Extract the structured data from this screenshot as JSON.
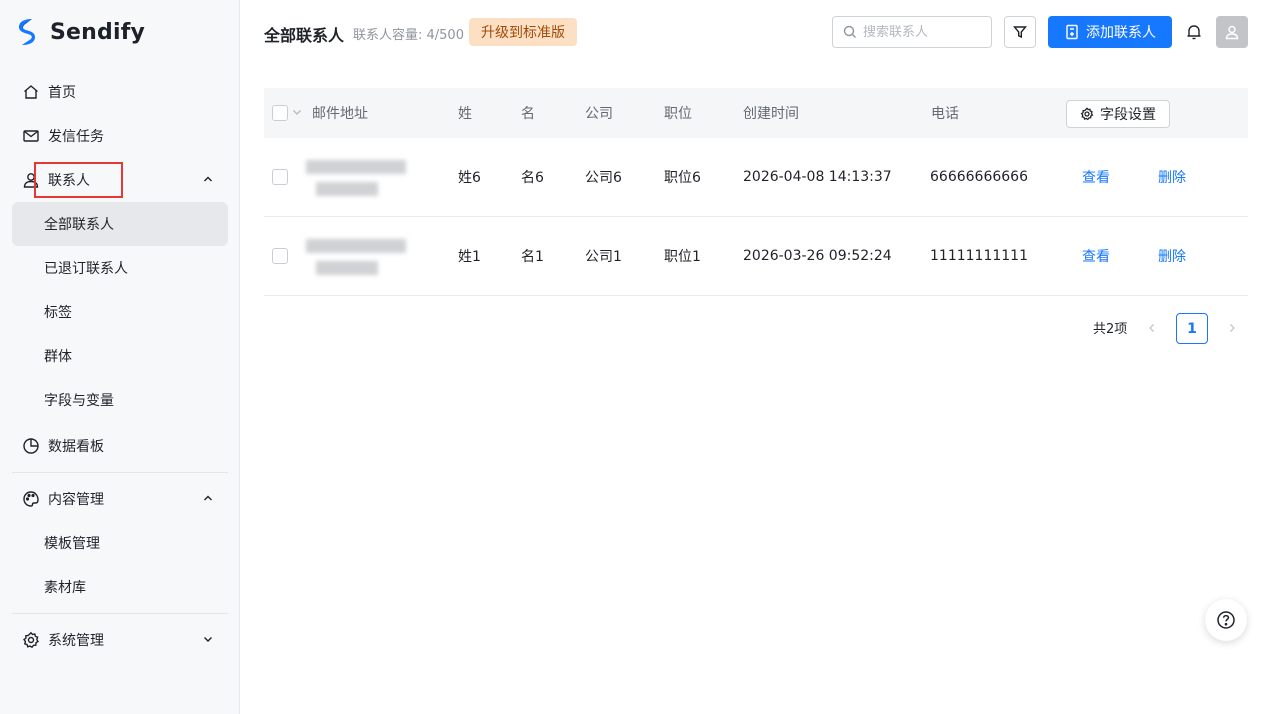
{
  "brand": {
    "name": "Sendify",
    "accent": "#1677ff"
  },
  "sidebar": {
    "items": [
      {
        "label": "首页",
        "icon": "home-icon"
      },
      {
        "label": "发信任务",
        "icon": "mail-icon"
      },
      {
        "label": "联系人",
        "icon": "user-icon",
        "expanded": true,
        "children": [
          "全部联系人",
          "已退订联系人",
          "标签",
          "群体",
          "字段与变量"
        ],
        "active_child": "全部联系人"
      },
      {
        "label": "数据看板",
        "icon": "pie-chart-icon"
      },
      {
        "label": "内容管理",
        "icon": "palette-icon",
        "expanded": true,
        "children": [
          "模板管理",
          "素材库"
        ]
      },
      {
        "label": "系统管理",
        "icon": "gear-icon",
        "expanded": false
      }
    ]
  },
  "header": {
    "title": "全部联系人",
    "capacity": "联系人容量: 4/500",
    "upgrade_label": "升级到标准版",
    "search_placeholder": "搜索联系人",
    "add_label": "添加联系人"
  },
  "table": {
    "columns": [
      "邮件地址",
      "姓",
      "名",
      "公司",
      "职位",
      "创建时间",
      "电话"
    ],
    "field_settings_label": "字段设置",
    "rows": [
      {
        "last": "姓6",
        "first": "名6",
        "company": "公司6",
        "title": "职位6",
        "created": "2026-04-08 14:13:37",
        "phone": "66666666666",
        "view": "查看",
        "delete": "删除"
      },
      {
        "last": "姓1",
        "first": "名1",
        "company": "公司1",
        "title": "职位1",
        "created": "2026-03-26 09:52:24",
        "phone": "11111111111",
        "view": "查看",
        "delete": "删除"
      }
    ]
  },
  "pagination": {
    "total": "共2项",
    "current": "1"
  }
}
